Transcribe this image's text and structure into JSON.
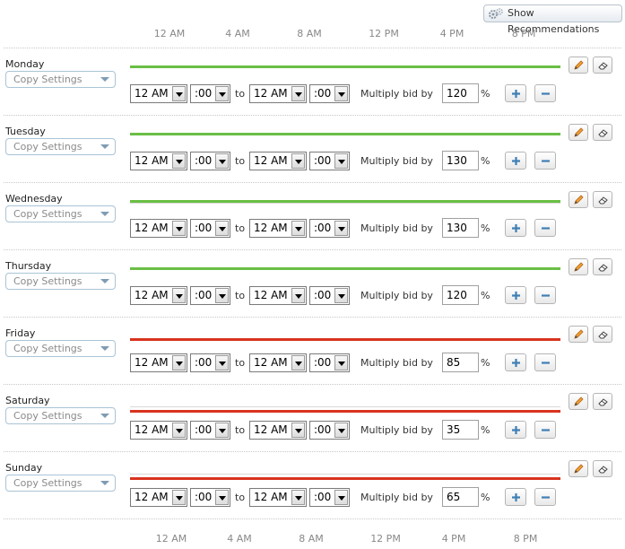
{
  "header": {
    "recommendations_label": "Show Recommendations",
    "recommendations_icon": "gears-icon"
  },
  "time_axis": [
    "12 AM",
    "4 AM",
    "8 AM",
    "12 PM",
    "4 PM",
    "8 PM"
  ],
  "row_labels": {
    "copy_settings": "Copy Settings",
    "to": "to",
    "multiply_bid_by": "Multiply bid by",
    "percent": "%"
  },
  "colors": {
    "increase": "#6abf45",
    "decrease": "#d8331f",
    "neutral": "#d9d9d9"
  },
  "days": [
    {
      "name": "Monday",
      "start_hour": "12 AM",
      "start_minute": ":00",
      "end_hour": "12 AM",
      "end_minute": ":00",
      "bid_multiplier": "120",
      "trend": "increase"
    },
    {
      "name": "Tuesday",
      "start_hour": "12 AM",
      "start_minute": ":00",
      "end_hour": "12 AM",
      "end_minute": ":00",
      "bid_multiplier": "130",
      "trend": "increase"
    },
    {
      "name": "Wednesday",
      "start_hour": "12 AM",
      "start_minute": ":00",
      "end_hour": "12 AM",
      "end_minute": ":00",
      "bid_multiplier": "130",
      "trend": "increase"
    },
    {
      "name": "Thursday",
      "start_hour": "12 AM",
      "start_minute": ":00",
      "end_hour": "12 AM",
      "end_minute": ":00",
      "bid_multiplier": "120",
      "trend": "increase"
    },
    {
      "name": "Friday",
      "start_hour": "12 AM",
      "start_minute": ":00",
      "end_hour": "12 AM",
      "end_minute": ":00",
      "bid_multiplier": "85",
      "trend": "decrease"
    },
    {
      "name": "Saturday",
      "start_hour": "12 AM",
      "start_minute": ":00",
      "end_hour": "12 AM",
      "end_minute": ":00",
      "bid_multiplier": "35",
      "trend": "decrease"
    },
    {
      "name": "Sunday",
      "start_hour": "12 AM",
      "start_minute": ":00",
      "end_hour": "12 AM",
      "end_minute": ":00",
      "bid_multiplier": "65",
      "trend": "decrease"
    }
  ]
}
